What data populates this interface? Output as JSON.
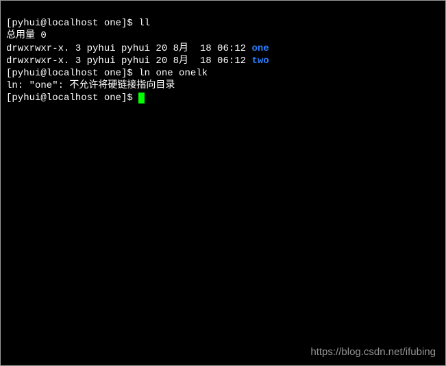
{
  "lines": [
    {
      "type": "prompt",
      "prompt": "[pyhui@localhost one]$ ",
      "command": "ll"
    },
    {
      "type": "output",
      "text": "总用量 0"
    },
    {
      "type": "listing",
      "perm": "drwxrwxr-x. 3 pyhui pyhui 20 8月  18 06:12 ",
      "name": "one"
    },
    {
      "type": "listing",
      "perm": "drwxrwxr-x. 3 pyhui pyhui 20 8月  18 06:12 ",
      "name": "two"
    },
    {
      "type": "prompt",
      "prompt": "[pyhui@localhost one]$ ",
      "command": "ln one onelk"
    },
    {
      "type": "output",
      "text": "ln: \"one\": 不允许将硬链接指向目录"
    },
    {
      "type": "prompt_cursor",
      "prompt": "[pyhui@localhost one]$ "
    }
  ],
  "watermark": "https://blog.csdn.net/ifubing"
}
